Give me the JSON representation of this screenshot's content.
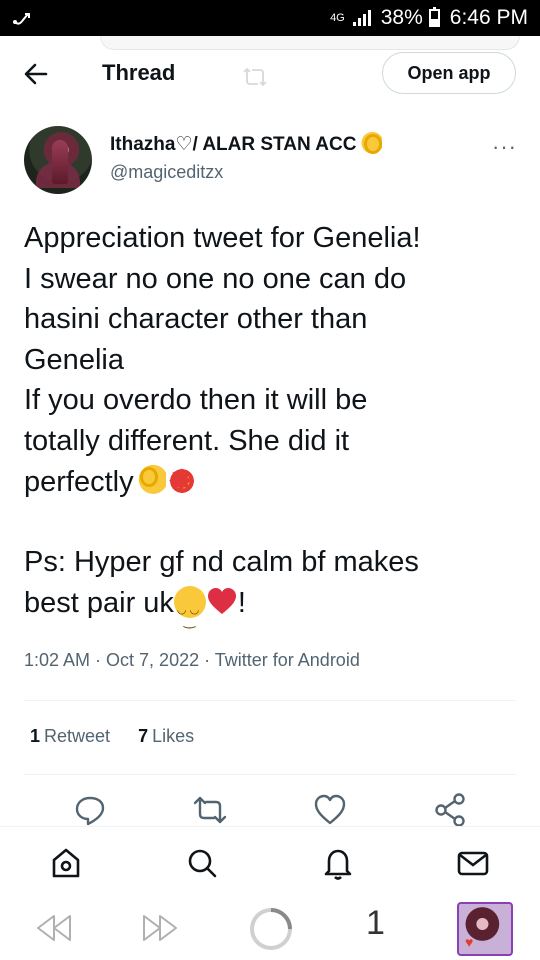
{
  "status_bar": {
    "left_icon": "usb-debug-icon",
    "network_type": "4G",
    "battery": "38%",
    "time": "6:46 PM"
  },
  "header": {
    "title": "Thread",
    "open_app_label": "Open app",
    "back_icon": "arrow-left-icon"
  },
  "tweet": {
    "author_name": "Ithazha♡/ ALAR STAN ACC",
    "author_handle": "@magiceditzx",
    "lines": [
      "Appreciation tweet for Genelia!",
      "I swear no one no one can do",
      "hasini character other than",
      "Genelia",
      "If you overdo then it will be",
      "totally different. She did it",
      "perfectly"
    ],
    "ps_line_1": "Ps: Hyper gf nd calm bf makes",
    "ps_line_2": "best pair uk",
    "ps_end": "!",
    "timestamp": "1:02 AM · Oct 7, 2022 · Twitter for Android",
    "retweets_count": "1",
    "retweets_label": "Retweet",
    "likes_count": "7",
    "likes_label": "Likes"
  },
  "bottom_nav": {
    "items": [
      "home-icon",
      "search-icon",
      "notifications-icon",
      "messages-icon"
    ]
  },
  "system_nav": {
    "page_number": "1"
  },
  "colors": {
    "text_primary": "#0f1419",
    "text_secondary": "#536471",
    "divider": "#eff3f4"
  }
}
